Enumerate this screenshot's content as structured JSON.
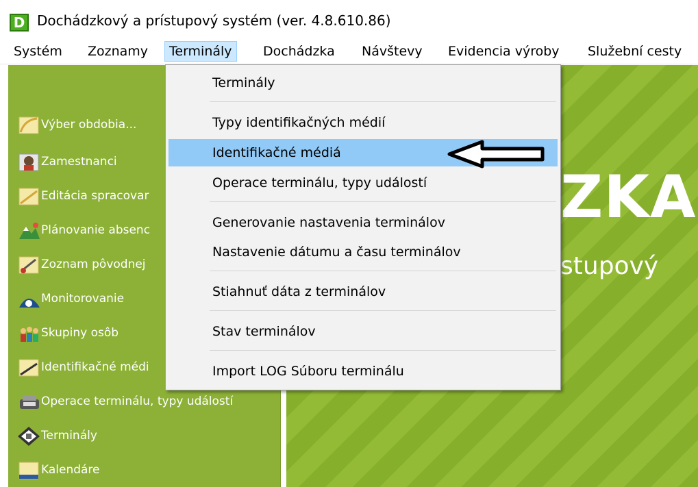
{
  "window": {
    "icon_letter": "D",
    "title": "Dochádzkový a prístupový systém (ver. 4.8.610.86)"
  },
  "menubar": {
    "items": [
      "Systém",
      "Zoznamy",
      "Terminály",
      "Dochádzka",
      "Návštevy",
      "Evidencia výroby",
      "Služební cesty"
    ],
    "active": "Terminály"
  },
  "sidebar": {
    "items": [
      {
        "label": "Výber obdobia...",
        "icon": "calendar-period-icon"
      },
      {
        "label": "Zamestnanci",
        "icon": "employee-icon"
      },
      {
        "label": "Editácia spracovar",
        "icon": "edit-processing-icon"
      },
      {
        "label": "Plánovanie absenc",
        "icon": "absence-planning-icon"
      },
      {
        "label": "Zoznam pôvodnej",
        "icon": "original-list-icon"
      },
      {
        "label": "Monitorovanie",
        "icon": "monitoring-icon"
      },
      {
        "label": "Skupiny osôb",
        "icon": "people-groups-icon"
      },
      {
        "label": "Identifikačné médi",
        "icon": "identification-media-icon"
      },
      {
        "label": "Operace terminálu, typy událostí",
        "icon": "terminal-operations-icon"
      },
      {
        "label": "Terminály",
        "icon": "terminal-icon"
      },
      {
        "label": "Kalendáre",
        "icon": "calendar-icon"
      }
    ]
  },
  "brand": {
    "big": "ZKA",
    "sub": "stupový"
  },
  "dropdown": {
    "items": [
      "Terminály",
      "Typy identifikačných médií",
      "Identifikačné médiá",
      "Operace terminálu, typy událostí",
      "Generovanie nastavenia terminálov",
      "Nastavenie dátumu a času terminálov",
      "Stiahnuť dáta z terminálov",
      "Stav terminálov",
      "Import LOG Súboru terminálu"
    ],
    "highlighted": "Identifikačné médiá"
  },
  "colors": {
    "green": "#8cb136",
    "highlight": "#91c9f7",
    "menu_active": "#cce8ff"
  }
}
